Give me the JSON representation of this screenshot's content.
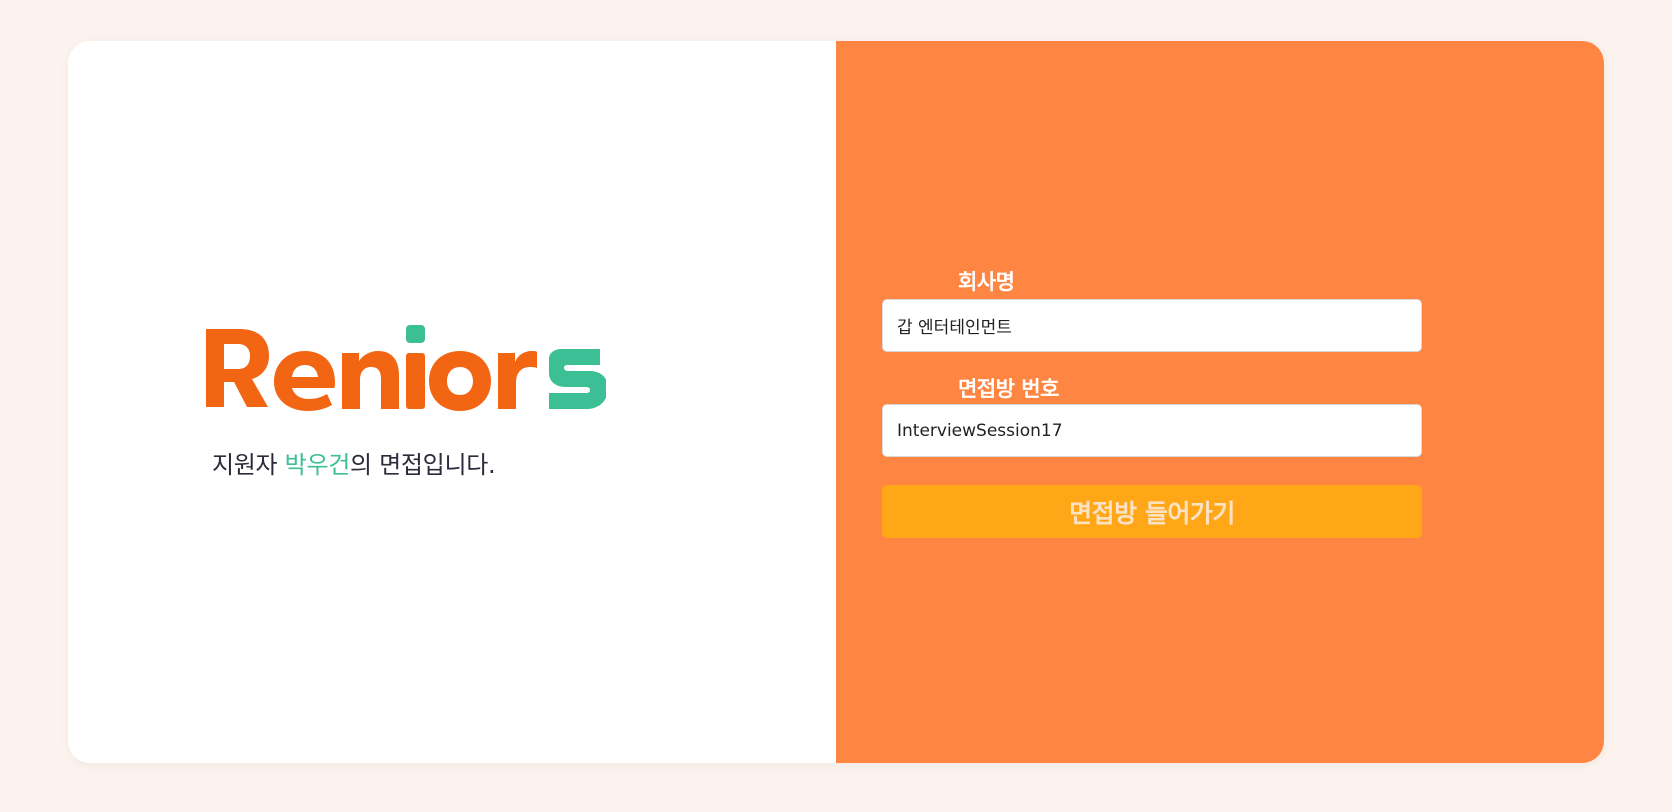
{
  "brand": {
    "logo_text": "Reniors",
    "logo_main": "Renior",
    "logo_accent": "s",
    "primary_color": "#f26512",
    "accent_color": "#3dbf95"
  },
  "greeting": {
    "prefix": "지원자 ",
    "applicant_name": "박우건",
    "suffix": "의 면접입니다."
  },
  "form": {
    "company_label": "회사명",
    "company_value": "갑 엔터테인먼트",
    "room_label": "면접방 번호",
    "room_value": "InterviewSession17",
    "submit_label": "면접방 들어가기",
    "panel_color": "#ff8642",
    "button_color": "#ffa716"
  }
}
